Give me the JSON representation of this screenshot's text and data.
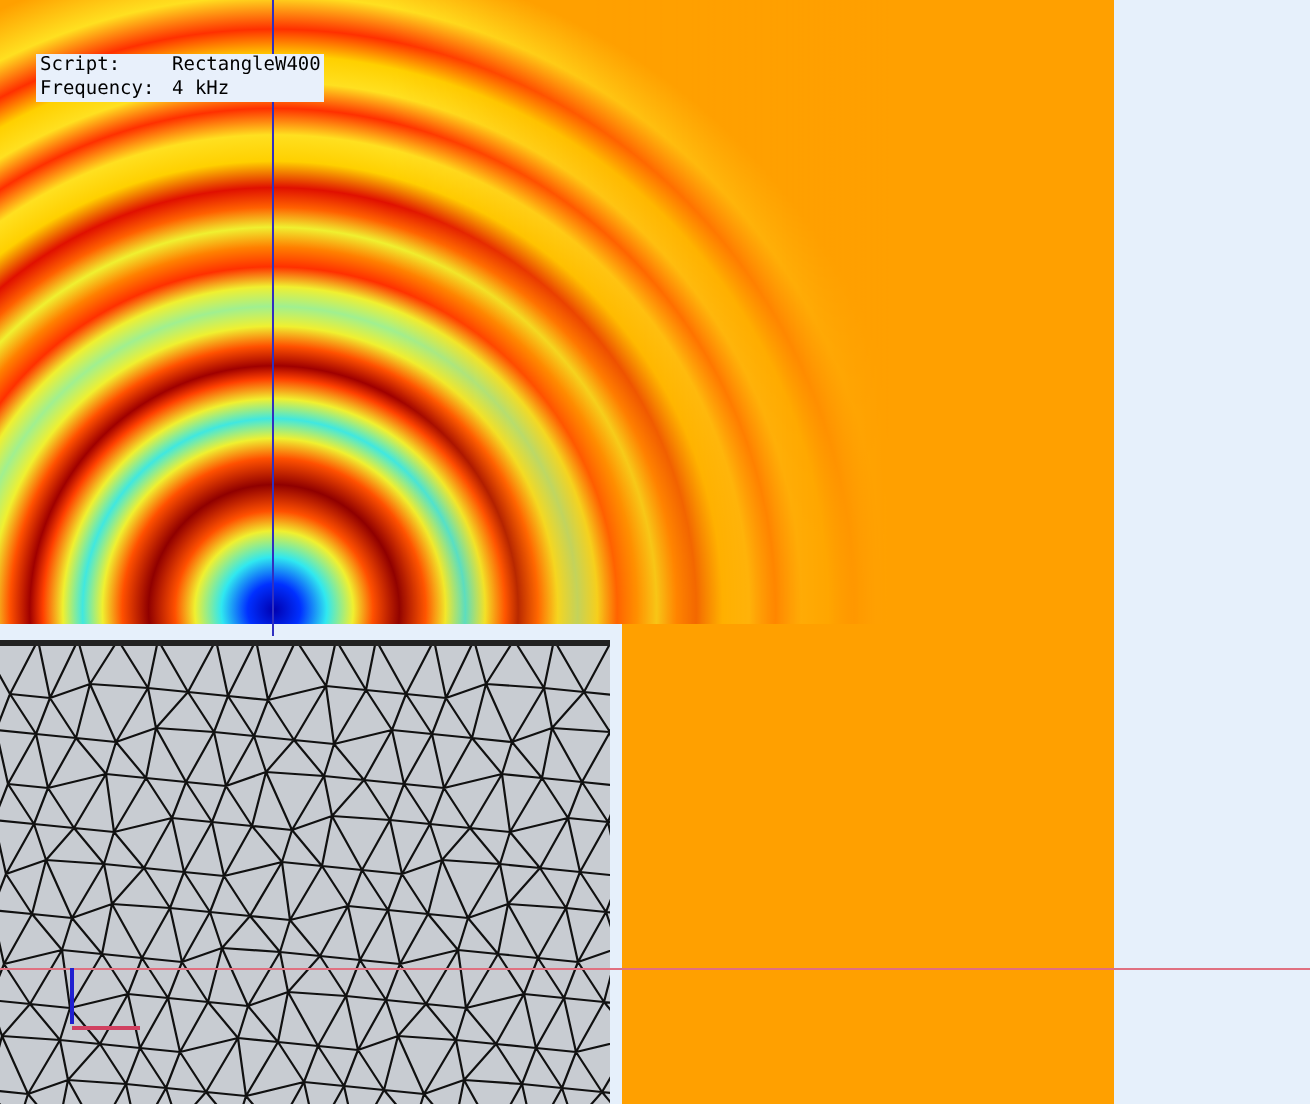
{
  "overlay_label": {
    "lines": [
      {
        "key": "Script:",
        "value": "RectangleW400"
      },
      {
        "key": "Frequency:",
        "value": "4 kHz"
      }
    ]
  }
}
